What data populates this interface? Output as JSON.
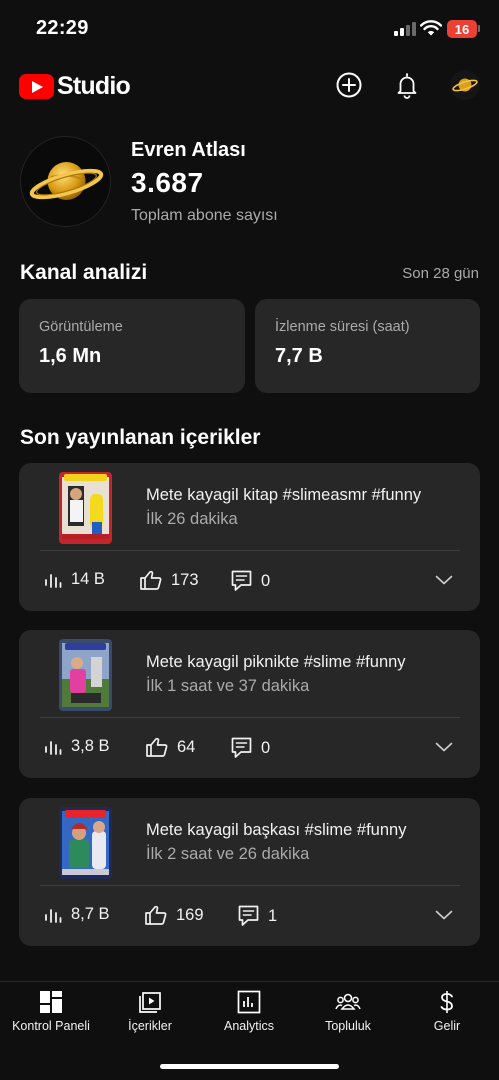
{
  "status_bar": {
    "time": "22:29",
    "battery": "16"
  },
  "header": {
    "logo_text": "Studio",
    "icons": [
      "add-icon",
      "bell-icon",
      "channel-avatar"
    ]
  },
  "channel": {
    "name": "Evren Atlası",
    "subscriber_count": "3.687",
    "subscriber_label": "Toplam abone sayısı"
  },
  "analytics": {
    "title": "Kanal analizi",
    "period": "Son 28 gün",
    "metrics": [
      {
        "label": "Görüntüleme",
        "value": "1,6 Mn"
      },
      {
        "label": "İzlenme süresi (saat)",
        "value": "7,7 B"
      }
    ]
  },
  "recent": {
    "title": "Son yayınlanan içerikler",
    "videos": [
      {
        "title": "Mete kayagil kitap #slimeasmr #funny",
        "age": "İlk 26 dakika",
        "views": "14 B",
        "likes": "173",
        "comments": "0"
      },
      {
        "title": "Mete kayagil piknikte #slime #funny",
        "age": "İlk 1 saat ve 37 dakika",
        "views": "3,8 B",
        "likes": "64",
        "comments": "0"
      },
      {
        "title": "Mete kayagil başkası #slime #funny",
        "age": "İlk 2 saat ve 26 dakika",
        "views": "8,7 B",
        "likes": "169",
        "comments": "1"
      }
    ]
  },
  "nav": {
    "items": [
      {
        "label": "Kontrol Paneli",
        "icon": "dashboard-icon"
      },
      {
        "label": "İçerikler",
        "icon": "content-icon"
      },
      {
        "label": "Analytics",
        "icon": "analytics-icon"
      },
      {
        "label": "Topluluk",
        "icon": "community-icon"
      },
      {
        "label": "Gelir",
        "icon": "earn-icon"
      }
    ]
  },
  "colors": {
    "background": "#0f0f0f",
    "card": "#272727",
    "brand_red": "#ff0000",
    "secondary_text": "#aaaaaa"
  }
}
